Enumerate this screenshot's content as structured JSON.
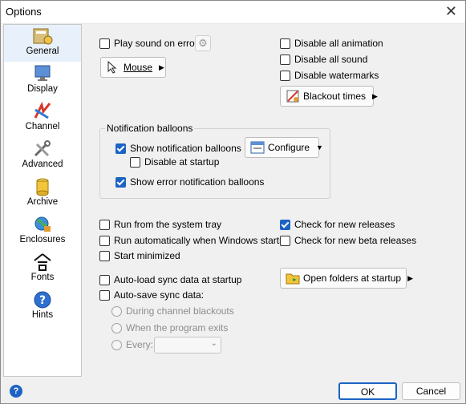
{
  "window": {
    "title": "Options",
    "close_label": "✕"
  },
  "sidebar": {
    "items": [
      {
        "label": "General",
        "icon": "general-icon"
      },
      {
        "label": "Display",
        "icon": "display-icon"
      },
      {
        "label": "Channel",
        "icon": "channel-icon"
      },
      {
        "label": "Advanced",
        "icon": "advanced-icon"
      },
      {
        "label": "Archive",
        "icon": "archive-icon"
      },
      {
        "label": "Enclosures",
        "icon": "enclosures-icon"
      },
      {
        "label": "Fonts",
        "icon": "fonts-icon"
      },
      {
        "label": "Hints",
        "icon": "hints-icon"
      }
    ],
    "active": "General"
  },
  "general": {
    "play_sound": {
      "label": "Play sound on error",
      "checked": false
    },
    "mouse_button": "Mouse",
    "disable_animation": {
      "label": "Disable all animation",
      "checked": false
    },
    "disable_sound": {
      "label": "Disable all sound",
      "checked": false
    },
    "disable_watermarks": {
      "label": "Disable watermarks",
      "checked": false
    },
    "blackout_button": "Blackout times",
    "notification_group": {
      "title": "Notification balloons",
      "show_balloons": {
        "label": "Show notification balloons",
        "checked": true
      },
      "disable_startup": {
        "label": "Disable at startup",
        "checked": false
      },
      "show_error": {
        "label": "Show error notification balloons",
        "checked": true
      },
      "configure_button": "Configure"
    },
    "run_tray": {
      "label": "Run from the system tray",
      "checked": false
    },
    "run_auto": {
      "label": "Run automatically when Windows starts",
      "checked": false
    },
    "start_min": {
      "label": "Start minimized",
      "checked": false
    },
    "check_releases": {
      "label": "Check for new releases",
      "checked": true
    },
    "check_beta": {
      "label": "Check for new beta releases",
      "checked": false
    },
    "autoload": {
      "label": "Auto-load sync data at startup",
      "checked": false
    },
    "autosave": {
      "label": "Auto-save sync data:",
      "checked": false
    },
    "during_blackouts": "During channel blackouts",
    "when_exits": "When the program exits",
    "every": "Every:",
    "every_value": "",
    "open_folders_button": "Open folders at startup"
  },
  "footer": {
    "ok": "OK",
    "cancel": "Cancel",
    "help": "?"
  },
  "colors": {
    "accent": "#1c63c4"
  }
}
